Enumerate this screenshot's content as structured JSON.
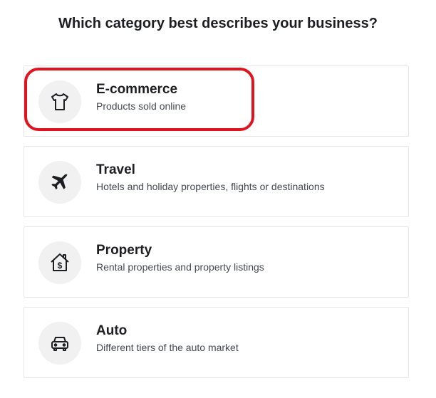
{
  "header": {
    "title": "Which category best describes your business?"
  },
  "categories": [
    {
      "title": "E-commerce",
      "description": "Products sold online",
      "icon": "tshirt-icon"
    },
    {
      "title": "Travel",
      "description": "Hotels and holiday properties, flights or destinations",
      "icon": "airplane-icon"
    },
    {
      "title": "Property",
      "description": "Rental properties and property listings",
      "icon": "house-dollar-icon"
    },
    {
      "title": "Auto",
      "description": "Different tiers of the auto market",
      "icon": "car-icon"
    }
  ],
  "annotation": {
    "highlight_color": "#e0141e",
    "highlighted_item": "E-commerce"
  }
}
